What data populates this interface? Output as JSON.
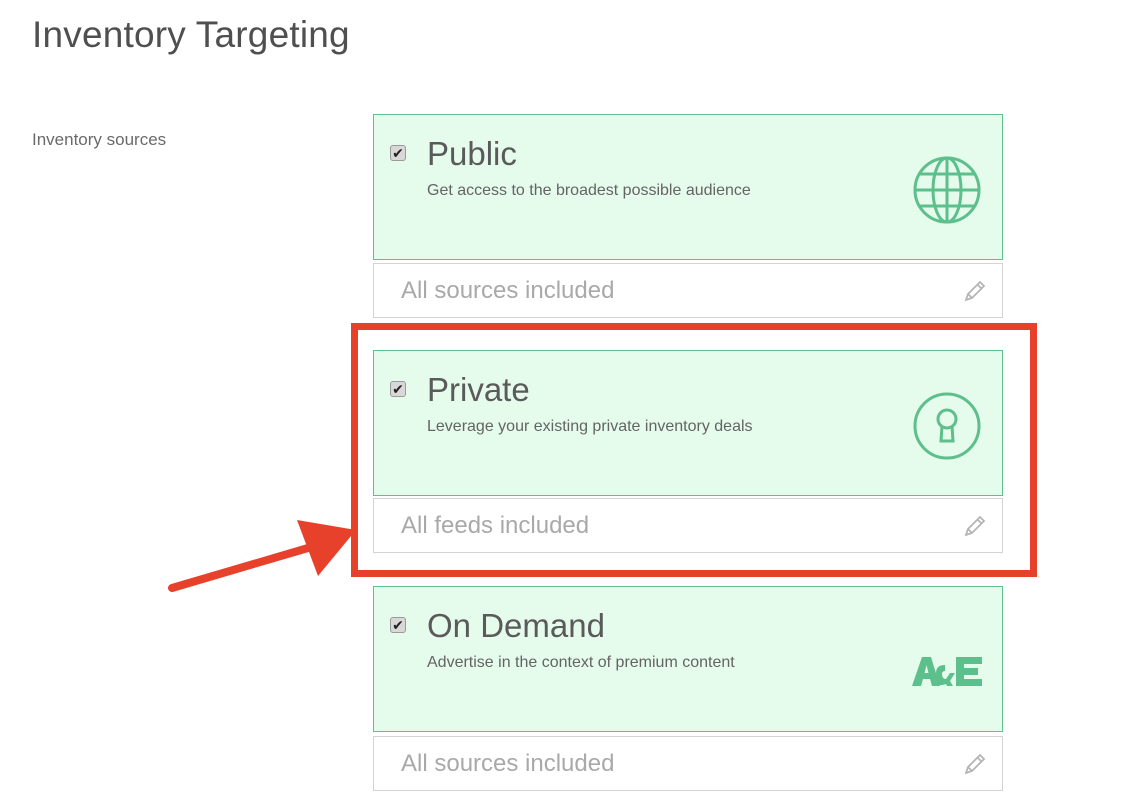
{
  "page": {
    "title": "Inventory Targeting"
  },
  "section": {
    "label": "Inventory sources"
  },
  "sources": [
    {
      "title": "Public",
      "description": "Get access to the broadest possible audience",
      "checked": true,
      "icon": "globe-icon",
      "footer": "All sources included"
    },
    {
      "title": "Private",
      "description": "Leverage your existing private inventory deals",
      "checked": true,
      "icon": "keyhole-icon",
      "footer": "All feeds included"
    },
    {
      "title": "On Demand",
      "description": "Advertise in the context of premium content",
      "checked": true,
      "icon": "ae-logo-icon",
      "footer": "All sources included"
    }
  ],
  "colors": {
    "card_background": "#e5fbec",
    "card_border": "#5fbf8e",
    "icon_green": "#5dbf8c",
    "annotation_red": "#e8412b"
  },
  "annotation": {
    "highlighted_source": "Private",
    "arrow": "points-to-private-source"
  }
}
